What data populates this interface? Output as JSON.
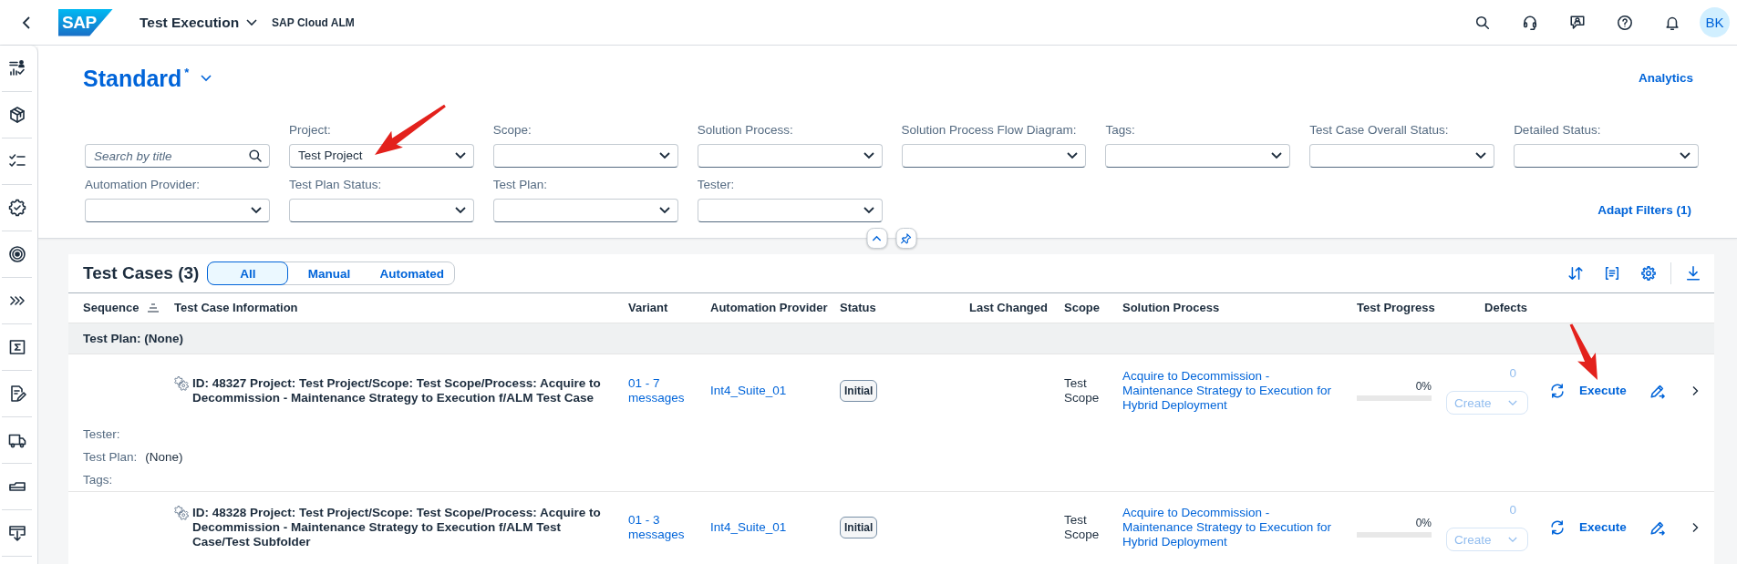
{
  "shell": {
    "logo": "SAP",
    "title": "Test Execution",
    "product": "SAP Cloud ALM",
    "avatar": "BK"
  },
  "variant": {
    "title": "Standard",
    "marker": "*"
  },
  "analytics_link": "Analytics",
  "filters": [
    {
      "kind": "search",
      "placeholder": "Search by title"
    },
    {
      "kind": "select",
      "label": "Project:",
      "value": "Test Project"
    },
    {
      "kind": "select",
      "label": "Scope:"
    },
    {
      "kind": "select",
      "label": "Solution Process:"
    },
    {
      "kind": "select",
      "label": "Solution Process Flow Diagram:"
    },
    {
      "kind": "select",
      "label": "Tags:"
    },
    {
      "kind": "select",
      "label": "Test Case Overall Status:"
    },
    {
      "kind": "select",
      "label": "Detailed Status:"
    },
    {
      "kind": "select",
      "label": "Automation Provider:"
    },
    {
      "kind": "select",
      "label": "Test Plan Status:"
    },
    {
      "kind": "select",
      "label": "Test Plan:"
    },
    {
      "kind": "select",
      "label": "Tester:"
    }
  ],
  "adapt_filters_link": "Adapt Filters (1)",
  "table": {
    "title": "Test Cases (3)",
    "segments": [
      {
        "label": "All",
        "selected": true
      },
      {
        "label": "Manual",
        "selected": false
      },
      {
        "label": "Automated",
        "selected": false
      }
    ],
    "columns": [
      {
        "label": "Sequence",
        "sorted": true
      },
      {
        "label": "Test Case Information",
        "sorted": false
      },
      {
        "label": "Variant",
        "sorted": false
      },
      {
        "label": "Automation Provider",
        "sorted": false
      },
      {
        "label": "Status",
        "sorted": false
      },
      {
        "label": "Last Changed",
        "sorted": false
      },
      {
        "label": "Scope",
        "sorted": false
      },
      {
        "label": "Solution Process",
        "sorted": false
      },
      {
        "label": "Test Progress",
        "sorted": false
      },
      {
        "label": "Defects",
        "sorted": false
      }
    ],
    "group": "Test Plan: (None)",
    "rows": [
      {
        "title": "ID: 48327 Project: Test Project/Scope: Test Scope/Process: Acquire to Decommission - Maintenance Strategy to Execution f/ALM Test Case",
        "variant": "01 - 7 messages",
        "provider": "Int4_Suite_01",
        "status": "Initial",
        "scope": "Test Scope",
        "solution_process": "Acquire to Decommission - Maintenance Strategy to Execution for Hybrid Deployment",
        "progress": {
          "level": 0,
          "reading": "0%"
        },
        "defects": {
          "count": "0",
          "disabled": true,
          "button": "Create"
        },
        "action": "Execute",
        "details": [
          {
            "label": "Tester:"
          },
          {
            "label": "Test Plan:",
            "value": "(None)"
          },
          {
            "label": "Tags:"
          }
        ]
      },
      {
        "title": "ID: 48328 Project: Test Project/Scope: Test Scope/Process: Acquire to Decommission - Maintenance Strategy to Execution f/ALM Test Case/Test Subfolder",
        "variant": "01 - 3 messages",
        "provider": "Int4_Suite_01",
        "status": "Initial",
        "scope": "Test Scope",
        "solution_process": "Acquire to Decommission - Maintenance Strategy to Execution for Hybrid Deployment",
        "progress": {
          "level": 0,
          "reading": "0%"
        },
        "defects": {
          "count": "0",
          "disabled": true,
          "button": "Create"
        },
        "action": "Execute"
      }
    ]
  }
}
